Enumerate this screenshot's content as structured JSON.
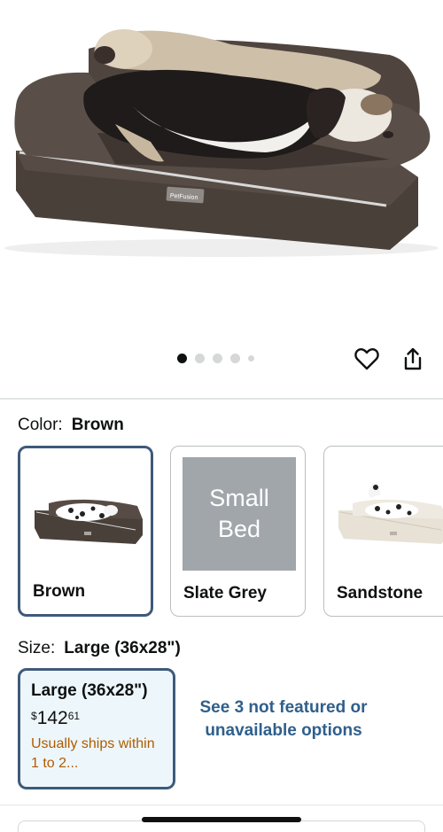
{
  "gallery": {
    "image_alt": "Brown dog bed with two basset hounds",
    "bed_logo_text": "PetFusion",
    "dot_count": 5,
    "active_dot": 0
  },
  "actions": {
    "favorite_icon": "heart-outline-icon",
    "share_icon": "share-icon"
  },
  "color": {
    "label": "Color:",
    "selected": "Brown",
    "options": [
      {
        "name": "Brown",
        "thumb": "brown-bed-thumbnail"
      },
      {
        "name": "Slate Grey",
        "thumb_line1": "Small",
        "thumb_line2": "Bed"
      },
      {
        "name": "Sandstone",
        "thumb": "sandstone-bed-thumbnail"
      }
    ]
  },
  "size": {
    "label": "Size:",
    "selected": "Large (36x28\")",
    "card": {
      "title": "Large (36x28\")",
      "currency": "$",
      "price_whole": "142",
      "price_cents": "61",
      "shipping": "Usually ships within 1 to 2..."
    },
    "see_more": "See 3 not featured or unavailable options"
  },
  "colors": {
    "selected_border": "#3e5a7a",
    "link": "#2f5f8c",
    "shipping": "#b05b00",
    "selected_bg": "#edf7fb"
  }
}
